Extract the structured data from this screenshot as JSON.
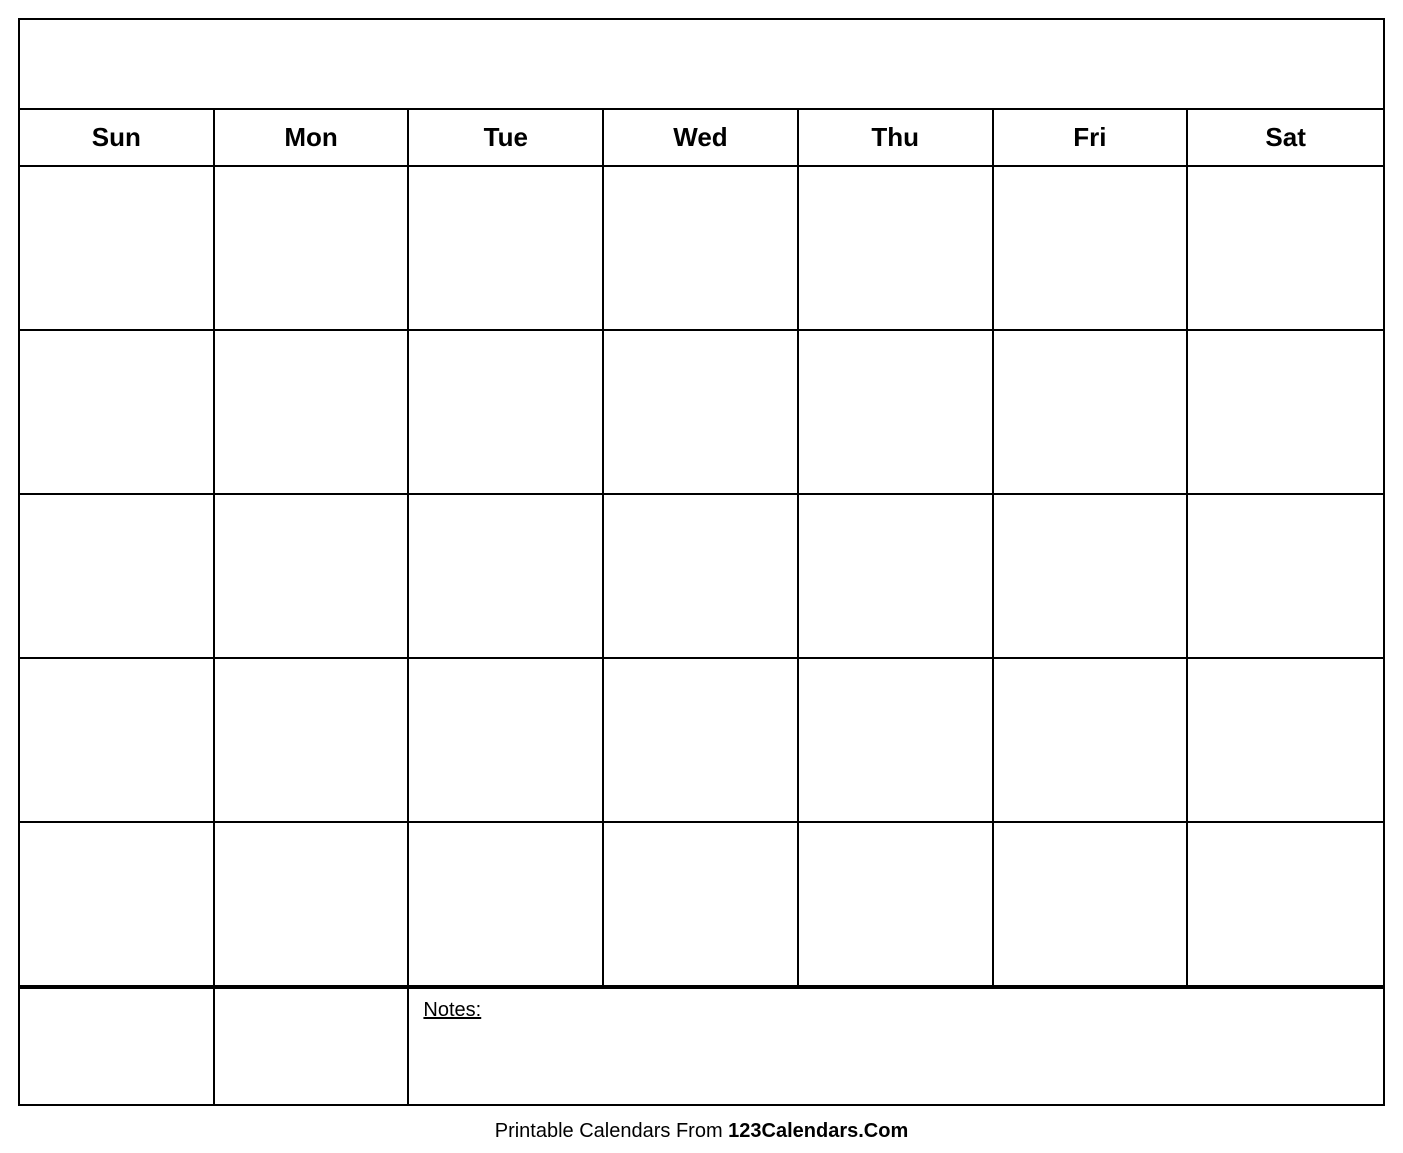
{
  "calendar": {
    "title": "",
    "days": [
      "Sun",
      "Mon",
      "Tue",
      "Wed",
      "Thu",
      "Fri",
      "Sat"
    ],
    "rows": 5,
    "notes_label": "Notes:"
  },
  "footer": {
    "prefix": "Printable Calendars From ",
    "brand": "123Calendars.Com"
  }
}
